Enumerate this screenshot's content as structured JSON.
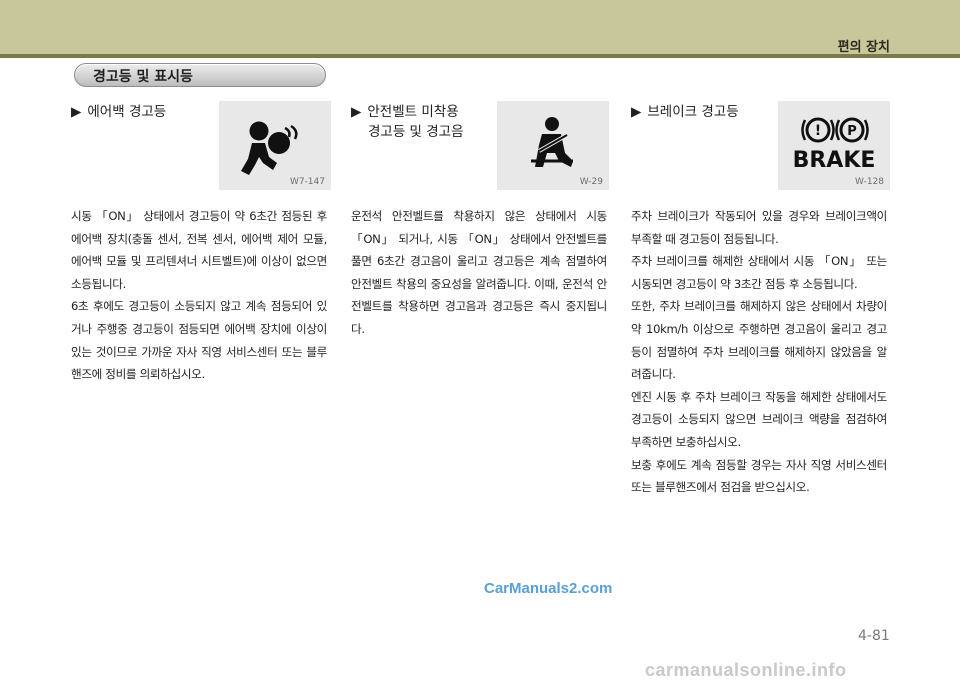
{
  "header": {
    "title": "편의 장치"
  },
  "section": {
    "title": "경고등 및 표시등"
  },
  "columns": [
    {
      "heading": [
        "에어백 경고등"
      ],
      "icon": {
        "name": "airbag-warning-icon",
        "code": "W7-147"
      },
      "paragraphs": [
        "시동 「ON」 상태에서 경고등이 약 6초간 점등된 후 에어백 장치(충돌 센서, 전복 센서, 에어백 제어 모듈, 에어백 모듈 및 프리텐셔너 시트벨트)에 이상이 없으면 소등됩니다.",
        "6초 후에도 경고등이 소등되지 않고 계속 점등되어 있거나 주행중 경고등이 점등되면 에어백 장치에 이상이 있는 것이므로 가까운 자사 직영 서비스센터 또는 블루핸즈에 정비를 의뢰하십시오."
      ]
    },
    {
      "heading": [
        "안전벨트 미착용",
        "경고등 및 경고음"
      ],
      "icon": {
        "name": "seatbelt-warning-icon",
        "code": "W-29"
      },
      "paragraphs": [
        "운전석 안전벨트를 착용하지 않은 상태에서 시동 「ON」 되거나, 시동 「ON」 상태에서 안전벨트를 풀면 6초간 경고음이 울리고 경고등은 계속 점멸하여 안전벨트 착용의 중요성을 알려줍니다. 이때, 운전석 안전벨트를 착용하면 경고음과 경고등은 즉시 중지됩니다."
      ]
    },
    {
      "heading": [
        "브레이크 경고등"
      ],
      "icon": {
        "name": "brake-warning-icon",
        "code": "W-128",
        "text": "BRAKE"
      },
      "paragraphs": [
        "주차 브레이크가 작동되어 있을 경우와 브레이크액이 부족할 때 경고등이 점등됩니다.",
        "주차 브레이크를 해제한 상태에서 시동 「ON」 또는 시동되면 경고등이 약 3초간 점등 후 소등됩니다.",
        "또한, 주차 브레이크를 해제하지 않은 상태에서 차량이 약 10km/h 이상으로 주행하면 경고음이 울리고 경고등이 점멸하여 주차 브레이크를 해제하지 않았음을 알려줍니다.",
        "엔진 시동 후 주차 브레이크 작동을 해제한 상태에서도 경고등이 소등되지 않으면 브레이크 액량을 점검하여 부족하면 보충하십시오.",
        "보충 후에도 계속 점등할 경우는 자사 직영 서비스센터 또는 블루핸즈에서 점검을 받으십시오."
      ]
    }
  ],
  "watermark": "CarManuals2.com",
  "page_number": "4-81",
  "footer_url": "carmanualsonline.info"
}
